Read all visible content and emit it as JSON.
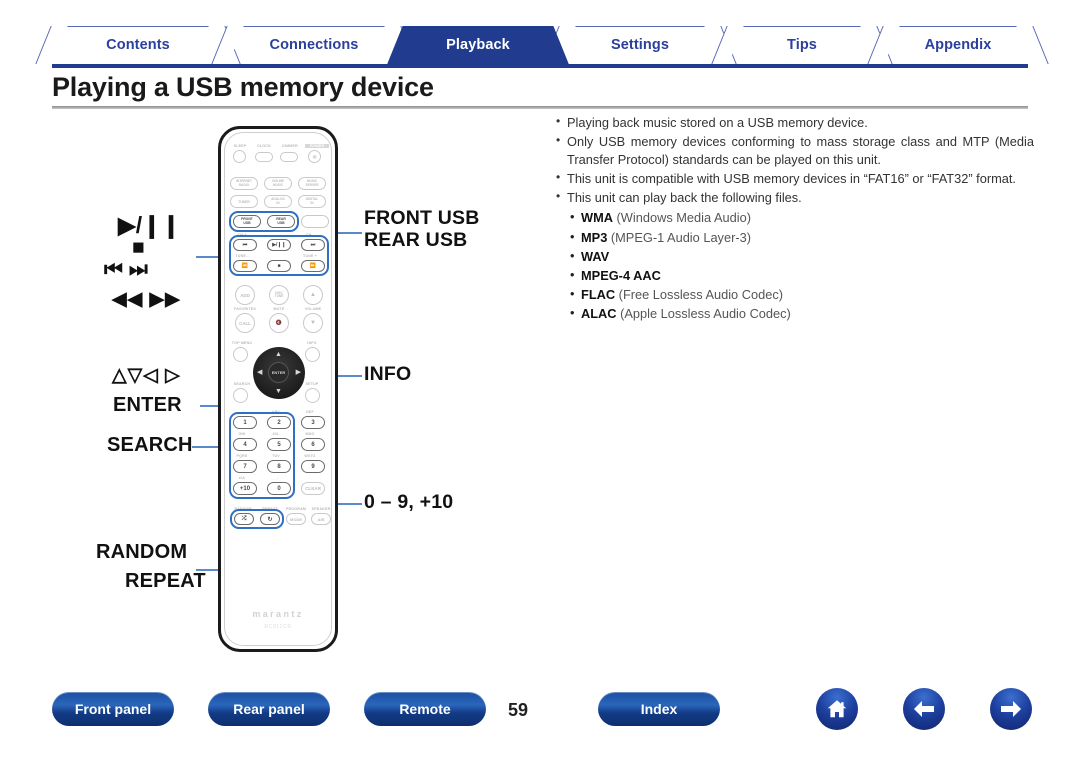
{
  "tabs": [
    {
      "label": "Contents",
      "active": false
    },
    {
      "label": "Connections",
      "active": false
    },
    {
      "label": "Playback",
      "active": true
    },
    {
      "label": "Settings",
      "active": false
    },
    {
      "label": "Tips",
      "active": false
    },
    {
      "label": "Appendix",
      "active": false
    }
  ],
  "page": {
    "title": "Playing a USB memory device",
    "number": "59"
  },
  "notes": [
    "Playing back music stored on a USB memory device.",
    "Only USB memory devices conforming to mass storage class and MTP (Media Transfer Protocol) standards can be played on this unit.",
    "This unit is compatible with USB memory devices in “FAT16” or “FAT32” format.",
    "This unit can play back the following files."
  ],
  "formats": [
    {
      "name": "WMA",
      "desc": " (Windows Media Audio)"
    },
    {
      "name": "MP3",
      "desc": " (MPEG-1 Audio Layer-3)"
    },
    {
      "name": "WAV",
      "desc": ""
    },
    {
      "name": "MPEG-4 AAC",
      "desc": ""
    },
    {
      "name": "FLAC",
      "desc": " (Free Lossless Audio Codec)"
    },
    {
      "name": "ALAC",
      "desc": " (Apple Lossless Audio Codec)"
    }
  ],
  "callouts_left": {
    "play_pause": "▶/❙❙",
    "stop": "■",
    "skip": "⏮⏭",
    "search_fwd_rev": "◀◀ ▶▶",
    "cursor": "△▽◁ ▷",
    "enter": "ENTER",
    "search": "SEARCH",
    "random": "RANDOM",
    "repeat": "REPEAT"
  },
  "callouts_right": {
    "front_usb": "FRONT USB",
    "rear_usb": "REAR USB",
    "info": "INFO",
    "numbers": "0 – 9, +10"
  },
  "remote": {
    "brand": "marantz",
    "model": "RC011CR",
    "row_top": [
      "SLEEP",
      "CLOCK",
      "DIMMER",
      "POWER"
    ],
    "row_sources_1": [
      "INTERNET RADIO",
      "ONLINE MUSIC",
      "MUSIC SERVER"
    ],
    "row_sources_2": [
      "TUNER",
      "ANALOG IN",
      "DIGITAL IN"
    ],
    "row_usb": [
      "FRONT USB",
      "REAR USB"
    ],
    "transport_labels": [
      "CH +",
      "CH -",
      "TUNE -",
      "TUNE +"
    ],
    "transport": [
      "⏮",
      "▶/❙❙",
      "⏭",
      "⏪",
      "■",
      "⏩"
    ],
    "row_fav": [
      "ADD",
      "DISC/TUNE",
      "VOLUME"
    ],
    "row_fav_labels": [
      "FAVORITES",
      "MUTE",
      "VOLUME"
    ],
    "row_call": [
      "CALL",
      "MUTE"
    ],
    "menu_labels": [
      "TOP MENU",
      "INFO",
      "SEARCH",
      "SETUP"
    ],
    "dpad_center": "ENTER",
    "keypad": [
      {
        "key": "1",
        "sub": ". /"
      },
      {
        "key": "2",
        "sub": "ABC"
      },
      {
        "key": "3",
        "sub": "DEF"
      },
      {
        "key": "4",
        "sub": "GHI"
      },
      {
        "key": "5",
        "sub": "JKL"
      },
      {
        "key": "6",
        "sub": "MNO"
      },
      {
        "key": "7",
        "sub": "PQRS"
      },
      {
        "key": "8",
        "sub": "TUV"
      },
      {
        "key": "9",
        "sub": "WXYZ"
      },
      {
        "key": "+10",
        "sub": "±/A"
      },
      {
        "key": "0",
        "sub": "_ -"
      },
      {
        "key": "CLEAR",
        "sub": ""
      }
    ],
    "bottom_row_labels": [
      "RANDOM",
      "REPEAT",
      "PROGRAM",
      "SPEAKER"
    ],
    "bottom_row": [
      "⤮",
      "↻",
      "MODE",
      "A/B"
    ]
  },
  "footer": {
    "buttons": [
      {
        "label": "Front panel"
      },
      {
        "label": "Rear panel"
      },
      {
        "label": "Remote"
      },
      {
        "label": "Index"
      }
    ],
    "icons": [
      "home-icon",
      "arrow-left-icon",
      "arrow-right-icon"
    ]
  },
  "colors": {
    "active_tab": "#213c8f",
    "tab_text": "#2b3f9e",
    "highlight": "#2f6fc4",
    "leader": "#5b89c9"
  }
}
